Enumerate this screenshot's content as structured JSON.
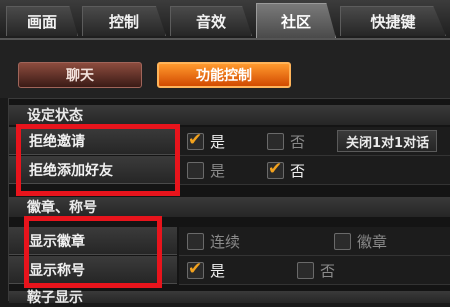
{
  "tabs": [
    {
      "label": "画面"
    },
    {
      "label": "控制"
    },
    {
      "label": "音效"
    },
    {
      "label": "社区",
      "active": true
    },
    {
      "label": "快捷键"
    }
  ],
  "buttons": {
    "chat": "聊天",
    "function_control": "功能控制"
  },
  "sections": {
    "settings_status": "设定状态",
    "badge_title": "徽章、称号",
    "bottom_partial": "鞍子显示"
  },
  "rows": {
    "refuse_invite": {
      "label": "拒绝邀请",
      "yes": "是",
      "no": "否",
      "yes_checked": true,
      "no_checked": false
    },
    "refuse_friend": {
      "label": "拒绝添加好友",
      "yes": "是",
      "no": "否",
      "yes_checked": false,
      "no_checked": true
    },
    "show_badge": {
      "label": "显示徽章",
      "opt1": "连续",
      "opt2": "徽章",
      "opt1_checked": false,
      "opt2_checked": false
    },
    "show_title": {
      "label": "显示称号",
      "yes": "是",
      "no": "否",
      "yes_checked": true,
      "no_checked": false
    }
  },
  "extra_button": "关闭1对1对话",
  "colors": {
    "accent": "#f2a21e",
    "highlight": "#e8141c",
    "active_button": "#ff7a1a"
  }
}
